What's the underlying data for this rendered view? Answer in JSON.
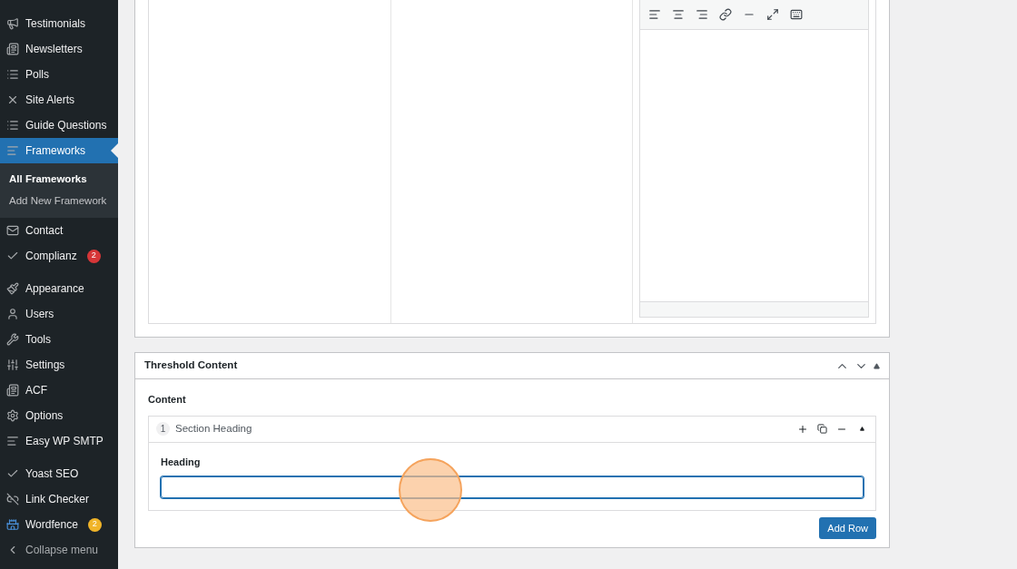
{
  "sidebar": {
    "items": [
      {
        "label": "Testimonials",
        "selected": false
      },
      {
        "label": "Newsletters",
        "selected": false
      },
      {
        "label": "Polls",
        "selected": false
      },
      {
        "label": "Site Alerts",
        "selected": false
      },
      {
        "label": "Guide Questions",
        "selected": false
      },
      {
        "label": "Frameworks",
        "selected": true,
        "children": [
          {
            "label": "All Frameworks",
            "selected": true
          },
          {
            "label": "Add New Framework",
            "selected": false
          }
        ]
      },
      {
        "label": "Contact",
        "selected": false
      },
      {
        "label": "Complianz",
        "selected": false,
        "badge": "2",
        "color": "#d63638"
      },
      {
        "label": "Appearance",
        "selected": false
      },
      {
        "label": "Users",
        "selected": false
      },
      {
        "label": "Tools",
        "selected": false
      },
      {
        "label": "Settings",
        "selected": false
      },
      {
        "label": "ACF",
        "selected": false
      },
      {
        "label": "Options",
        "selected": false
      },
      {
        "label": "Easy WP SMTP",
        "selected": false
      },
      {
        "label": "Yoast SEO",
        "selected": false
      },
      {
        "label": "Link Checker",
        "selected": false
      },
      {
        "label": "Wordfence",
        "selected": false,
        "badge": "2",
        "color": "#f0b429"
      },
      {
        "label": "Collapse menu",
        "selected": false
      }
    ]
  },
  "threshold": {
    "title": "Threshold Content",
    "field_label": "Content",
    "row": {
      "number": "1",
      "title": "Section Heading",
      "field_label": "Heading"
    },
    "add_button": "Add Row"
  }
}
